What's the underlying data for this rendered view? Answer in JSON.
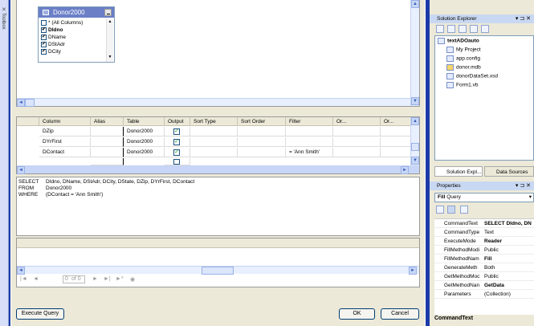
{
  "toolbox": {
    "label": "Toolbox"
  },
  "diagram": {
    "table_title": "Donor2000",
    "columns": [
      {
        "name": "* (All Columns)",
        "checked": false,
        "bold": false
      },
      {
        "name": "DIdno",
        "checked": true,
        "bold": true
      },
      {
        "name": "DName",
        "checked": true,
        "bold": false
      },
      {
        "name": "DStAdr",
        "checked": true,
        "bold": false
      },
      {
        "name": "DCity",
        "checked": true,
        "bold": false
      }
    ]
  },
  "grid": {
    "headers": [
      "Column",
      "Alias",
      "Table",
      "Output",
      "Sort Type",
      "Sort Order",
      "Filter",
      "Or...",
      "Or..."
    ],
    "rows": [
      {
        "column": "DZip",
        "alias": "",
        "table": "Donor2000",
        "output": true,
        "filter": ""
      },
      {
        "column": "DYrFirst",
        "alias": "",
        "table": "Donor2000",
        "output": true,
        "filter": ""
      },
      {
        "column": "DContact",
        "alias": "",
        "table": "Donor2000",
        "output": true,
        "filter": "= 'Ann Smith'"
      }
    ]
  },
  "sql": {
    "select_kw": "SELECT",
    "select_text": "DIdno, DName, DStAdr, DCity, DState, DZip, DYrFirst, DContact",
    "from_kw": "FROM",
    "from_text": "Donor2000",
    "where_kw": "WHERE",
    "where_text": "(DContact = 'Ann Smith')"
  },
  "navigator": {
    "first": "|◄",
    "prev": "◄",
    "position": "0",
    "of_label": "of 0",
    "next": "►",
    "last": "►|",
    "new": "►*",
    "stop": "◉"
  },
  "buttons": {
    "execute": "Execute Query",
    "ok": "OK",
    "cancel": "Cancel"
  },
  "solution_explorer": {
    "title": "Solution Explorer",
    "pin": "▾ ⊐ ✕",
    "tree": [
      {
        "label": "textADOauto",
        "bold": true,
        "icon": "project-icon"
      },
      {
        "label": "My Project",
        "bold": false,
        "icon": "my-project-icon"
      },
      {
        "label": "app.config",
        "bold": false,
        "icon": "config-file-icon"
      },
      {
        "label": "donor.mdb",
        "bold": false,
        "icon": "database-file-icon"
      },
      {
        "label": "donorDataSet.xsd",
        "bold": false,
        "icon": "dataset-file-icon"
      },
      {
        "label": "Form1.vb",
        "bold": false,
        "icon": "form-file-icon"
      }
    ],
    "tabs": [
      "Solution Expl...",
      "Data Sources"
    ]
  },
  "properties": {
    "title": "Properties",
    "pin": "▾ ⊐ ✕",
    "object_name": "Fill",
    "object_type": "Query",
    "rows": [
      {
        "name": "CommandText",
        "value": "SELECT DIdno, DN",
        "bold": true
      },
      {
        "name": "CommandType",
        "value": "Text",
        "bold": false
      },
      {
        "name": "ExecuteMode",
        "value": "Reader",
        "bold": true
      },
      {
        "name": "FillMethodModi",
        "value": "Public",
        "bold": false
      },
      {
        "name": "FillMethodNam",
        "value": "Fill",
        "bold": true
      },
      {
        "name": "GenerateMeth",
        "value": "Both",
        "bold": false
      },
      {
        "name": "GetMethodMoc",
        "value": "Public",
        "bold": false
      },
      {
        "name": "GetMethodNan",
        "value": "GetData",
        "bold": true
      },
      {
        "name": "Parameters",
        "value": "(Collection)",
        "bold": false
      }
    ],
    "description_title": "CommandText"
  }
}
